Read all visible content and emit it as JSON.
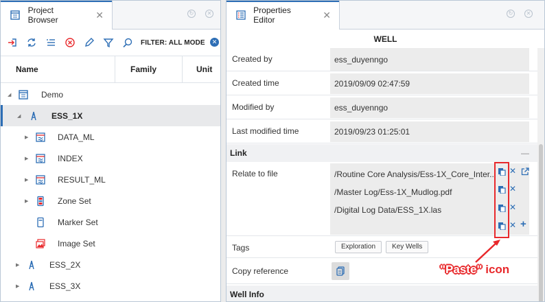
{
  "project_browser": {
    "tab_label": "Project Browser",
    "filter_label": "FILTER: ALL MODE",
    "columns": [
      "Name",
      "Family",
      "Unit"
    ],
    "tree": [
      {
        "label": "Demo",
        "icon": "project-icon"
      },
      {
        "label": "ESS_1X",
        "icon": "well-icon"
      },
      {
        "label": "DATA_ML",
        "icon": "dataset-icon"
      },
      {
        "label": "INDEX",
        "icon": "dataset-icon"
      },
      {
        "label": "RESULT_ML",
        "icon": "dataset-icon"
      },
      {
        "label": "Zone Set",
        "icon": "zone-set-icon"
      },
      {
        "label": "Marker Set",
        "icon": "marker-set-icon"
      },
      {
        "label": "Image Set",
        "icon": "image-set-icon"
      },
      {
        "label": "ESS_2X",
        "icon": "well-icon"
      },
      {
        "label": "ESS_3X",
        "icon": "well-icon"
      }
    ]
  },
  "properties_editor": {
    "tab_label": "Properties Editor",
    "title": "WELL",
    "rows": [
      {
        "label": "Created by",
        "value": "ess_duyenngo"
      },
      {
        "label": "Created time",
        "value": "2019/09/09 02:47:59"
      },
      {
        "label": "Modified by",
        "value": "ess_duyenngo"
      },
      {
        "label": "Last modified time",
        "value": "2019/09/23 01:25:01"
      }
    ],
    "link_section": "Link",
    "relate_label": "Relate to file",
    "files": [
      "/Routine Core Analysis/Ess-1X_Core_Inter...",
      "/Master Log/Ess-1X_Mudlog.pdf",
      "/Digital Log Data/ESS_1X.las"
    ],
    "tags_label": "Tags",
    "tags": [
      "Exploration",
      "Key Wells"
    ],
    "copy_reference_label": "Copy reference",
    "well_info_section": "Well Info",
    "collapse_symbol": "—"
  },
  "annotation": {
    "paste_text": "\"Paste\"",
    "icon_text": "icon"
  },
  "colors": {
    "accent": "#2d6eb5",
    "annotation_red": "#e8282b"
  }
}
